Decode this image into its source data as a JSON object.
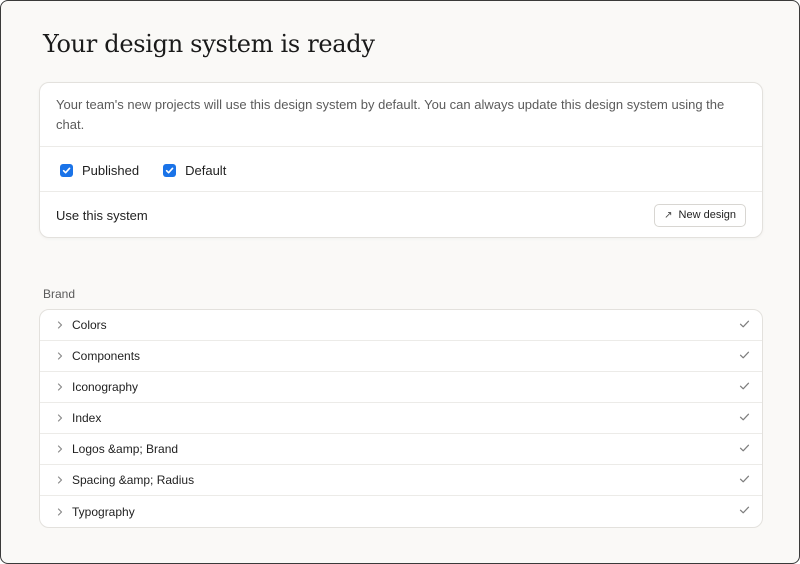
{
  "page": {
    "title": "Your design system is ready"
  },
  "card": {
    "description": "Your team's new projects will use this design system by default. You can always update this design system using the chat.",
    "checkboxes": [
      {
        "label": "Published",
        "checked": true
      },
      {
        "label": "Default",
        "checked": true
      }
    ],
    "use_label": "Use this system",
    "new_design_button": "New design",
    "new_design_icon": "arrow-up-right-icon"
  },
  "brand": {
    "section_label": "Brand",
    "items": [
      {
        "label": "Colors",
        "status": "check-icon"
      },
      {
        "label": "Components",
        "status": "check-icon"
      },
      {
        "label": "Iconography",
        "status": "check-icon"
      },
      {
        "label": "Index",
        "status": "check-icon"
      },
      {
        "label": "Logos &amp; Brand",
        "status": "check-icon"
      },
      {
        "label": "Spacing &amp; Radius",
        "status": "check-icon"
      },
      {
        "label": "Typography",
        "status": "check-icon"
      }
    ]
  },
  "colors": {
    "accent": "#1a73e8",
    "background": "#faf9f7"
  }
}
